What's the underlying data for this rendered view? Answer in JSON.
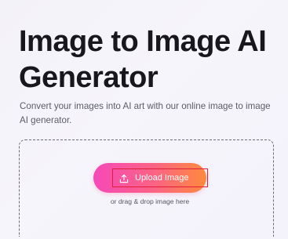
{
  "hero": {
    "title": "Image to Image AI Generator",
    "subtitle": "Convert your images into AI art with our online image to image AI generator."
  },
  "upload": {
    "button_label": "Upload Image",
    "icon": "upload-icon",
    "hint": "or drag & drop image here"
  },
  "colors": {
    "button_gradient_start": "#f648b8",
    "button_gradient_end": "#ff8a3d",
    "highlight_border": "#e0203a"
  }
}
